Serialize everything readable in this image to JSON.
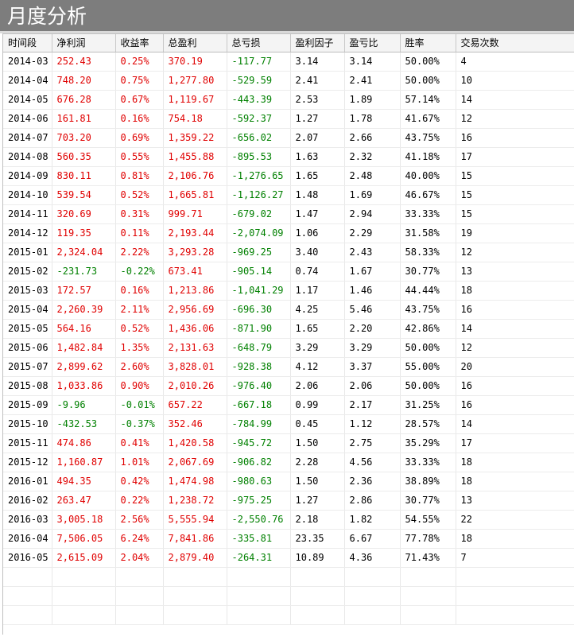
{
  "window": {
    "title": "月度分析"
  },
  "colors": {
    "positive": "#e00000",
    "negative": "#008000",
    "header_bg": "#f4f4f4",
    "titlebar_bg": "#7d7d7d"
  },
  "table": {
    "columns": [
      "时间段",
      "净利润",
      "收益率",
      "总盈利",
      "总亏损",
      "盈利因子",
      "盈亏比",
      "胜率",
      "交易次数"
    ],
    "rows": [
      [
        "2014-03",
        "252.43",
        "0.25%",
        "370.19",
        "-117.77",
        "3.14",
        "3.14",
        "50.00%",
        "4"
      ],
      [
        "2014-04",
        "748.20",
        "0.75%",
        "1,277.80",
        "-529.59",
        "2.41",
        "2.41",
        "50.00%",
        "10"
      ],
      [
        "2014-05",
        "676.28",
        "0.67%",
        "1,119.67",
        "-443.39",
        "2.53",
        "1.89",
        "57.14%",
        "14"
      ],
      [
        "2014-06",
        "161.81",
        "0.16%",
        "754.18",
        "-592.37",
        "1.27",
        "1.78",
        "41.67%",
        "12"
      ],
      [
        "2014-07",
        "703.20",
        "0.69%",
        "1,359.22",
        "-656.02",
        "2.07",
        "2.66",
        "43.75%",
        "16"
      ],
      [
        "2014-08",
        "560.35",
        "0.55%",
        "1,455.88",
        "-895.53",
        "1.63",
        "2.32",
        "41.18%",
        "17"
      ],
      [
        "2014-09",
        "830.11",
        "0.81%",
        "2,106.76",
        "-1,276.65",
        "1.65",
        "2.48",
        "40.00%",
        "15"
      ],
      [
        "2014-10",
        "539.54",
        "0.52%",
        "1,665.81",
        "-1,126.27",
        "1.48",
        "1.69",
        "46.67%",
        "15"
      ],
      [
        "2014-11",
        "320.69",
        "0.31%",
        "999.71",
        "-679.02",
        "1.47",
        "2.94",
        "33.33%",
        "15"
      ],
      [
        "2014-12",
        "119.35",
        "0.11%",
        "2,193.44",
        "-2,074.09",
        "1.06",
        "2.29",
        "31.58%",
        "19"
      ],
      [
        "2015-01",
        "2,324.04",
        "2.22%",
        "3,293.28",
        "-969.25",
        "3.40",
        "2.43",
        "58.33%",
        "12"
      ],
      [
        "2015-02",
        "-231.73",
        "-0.22%",
        "673.41",
        "-905.14",
        "0.74",
        "1.67",
        "30.77%",
        "13"
      ],
      [
        "2015-03",
        "172.57",
        "0.16%",
        "1,213.86",
        "-1,041.29",
        "1.17",
        "1.46",
        "44.44%",
        "18"
      ],
      [
        "2015-04",
        "2,260.39",
        "2.11%",
        "2,956.69",
        "-696.30",
        "4.25",
        "5.46",
        "43.75%",
        "16"
      ],
      [
        "2015-05",
        "564.16",
        "0.52%",
        "1,436.06",
        "-871.90",
        "1.65",
        "2.20",
        "42.86%",
        "14"
      ],
      [
        "2015-06",
        "1,482.84",
        "1.35%",
        "2,131.63",
        "-648.79",
        "3.29",
        "3.29",
        "50.00%",
        "12"
      ],
      [
        "2015-07",
        "2,899.62",
        "2.60%",
        "3,828.01",
        "-928.38",
        "4.12",
        "3.37",
        "55.00%",
        "20"
      ],
      [
        "2015-08",
        "1,033.86",
        "0.90%",
        "2,010.26",
        "-976.40",
        "2.06",
        "2.06",
        "50.00%",
        "16"
      ],
      [
        "2015-09",
        "-9.96",
        "-0.01%",
        "657.22",
        "-667.18",
        "0.99",
        "2.17",
        "31.25%",
        "16"
      ],
      [
        "2015-10",
        "-432.53",
        "-0.37%",
        "352.46",
        "-784.99",
        "0.45",
        "1.12",
        "28.57%",
        "14"
      ],
      [
        "2015-11",
        "474.86",
        "0.41%",
        "1,420.58",
        "-945.72",
        "1.50",
        "2.75",
        "35.29%",
        "17"
      ],
      [
        "2015-12",
        "1,160.87",
        "1.01%",
        "2,067.69",
        "-906.82",
        "2.28",
        "4.56",
        "33.33%",
        "18"
      ],
      [
        "2016-01",
        "494.35",
        "0.42%",
        "1,474.98",
        "-980.63",
        "1.50",
        "2.36",
        "38.89%",
        "18"
      ],
      [
        "2016-02",
        "263.47",
        "0.22%",
        "1,238.72",
        "-975.25",
        "1.27",
        "2.86",
        "30.77%",
        "13"
      ],
      [
        "2016-03",
        "3,005.18",
        "2.56%",
        "5,555.94",
        "-2,550.76",
        "2.18",
        "1.82",
        "54.55%",
        "22"
      ],
      [
        "2016-04",
        "7,506.05",
        "6.24%",
        "7,841.86",
        "-335.81",
        "23.35",
        "6.67",
        "77.78%",
        "18"
      ],
      [
        "2016-05",
        "2,615.09",
        "2.04%",
        "2,879.40",
        "-264.31",
        "10.89",
        "4.36",
        "71.43%",
        "7"
      ]
    ]
  }
}
